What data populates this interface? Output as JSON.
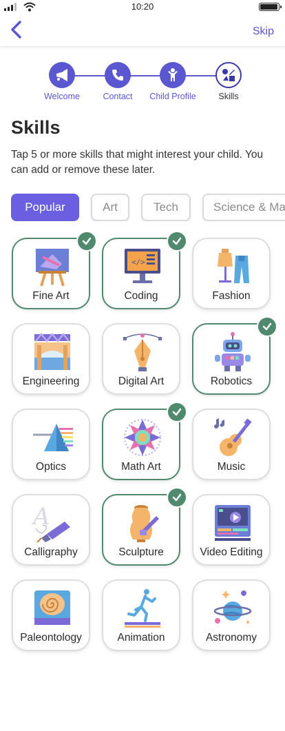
{
  "status_bar": {
    "time": "10:20",
    "battery_level": 1.0
  },
  "header": {
    "skip_label": "Skip"
  },
  "stepper": {
    "steps": [
      {
        "label": "Welcome",
        "icon": "trumpet-icon",
        "state": "done"
      },
      {
        "label": "Contact",
        "icon": "phone-icon",
        "state": "done"
      },
      {
        "label": "Child Profile",
        "icon": "child-icon",
        "state": "done"
      },
      {
        "label": "Skills",
        "icon": "skills-icon",
        "state": "current"
      }
    ]
  },
  "page": {
    "title": "Skills",
    "instructions": "Tap 5 or more skills that might interest your child. You can add or remove these later."
  },
  "tabs": [
    {
      "label": "Popular",
      "active": true
    },
    {
      "label": "Art",
      "active": false
    },
    {
      "label": "Tech",
      "active": false
    },
    {
      "label": "Science & Math",
      "active": false
    }
  ],
  "skills": [
    {
      "label": "Fine Art",
      "icon": "easel-icon",
      "selected": true
    },
    {
      "label": "Coding",
      "icon": "code-monitor-icon",
      "selected": true
    },
    {
      "label": "Fashion",
      "icon": "mannequin-icon",
      "selected": false
    },
    {
      "label": "Engineering",
      "icon": "bridge-icon",
      "selected": false
    },
    {
      "label": "Digital Art",
      "icon": "pen-tool-icon",
      "selected": false
    },
    {
      "label": "Robotics",
      "icon": "robot-icon",
      "selected": true
    },
    {
      "label": "Optics",
      "icon": "prism-icon",
      "selected": false
    },
    {
      "label": "Math Art",
      "icon": "mandala-icon",
      "selected": true
    },
    {
      "label": "Music",
      "icon": "guitar-icon",
      "selected": false
    },
    {
      "label": "Calligraphy",
      "icon": "fountain-pen-icon",
      "selected": false
    },
    {
      "label": "Sculpture",
      "icon": "vase-icon",
      "selected": true
    },
    {
      "label": "Video Editing",
      "icon": "video-editor-icon",
      "selected": false
    },
    {
      "label": "Paleontology",
      "icon": "fossil-icon",
      "selected": false
    },
    {
      "label": "Animation",
      "icon": "running-figure-icon",
      "selected": false
    },
    {
      "label": "Astronomy",
      "icon": "planet-icon",
      "selected": false
    }
  ],
  "colors": {
    "accent": "#5b57d1",
    "tab_active": "#6a5fe0",
    "selected_border": "#4f8a6e"
  }
}
